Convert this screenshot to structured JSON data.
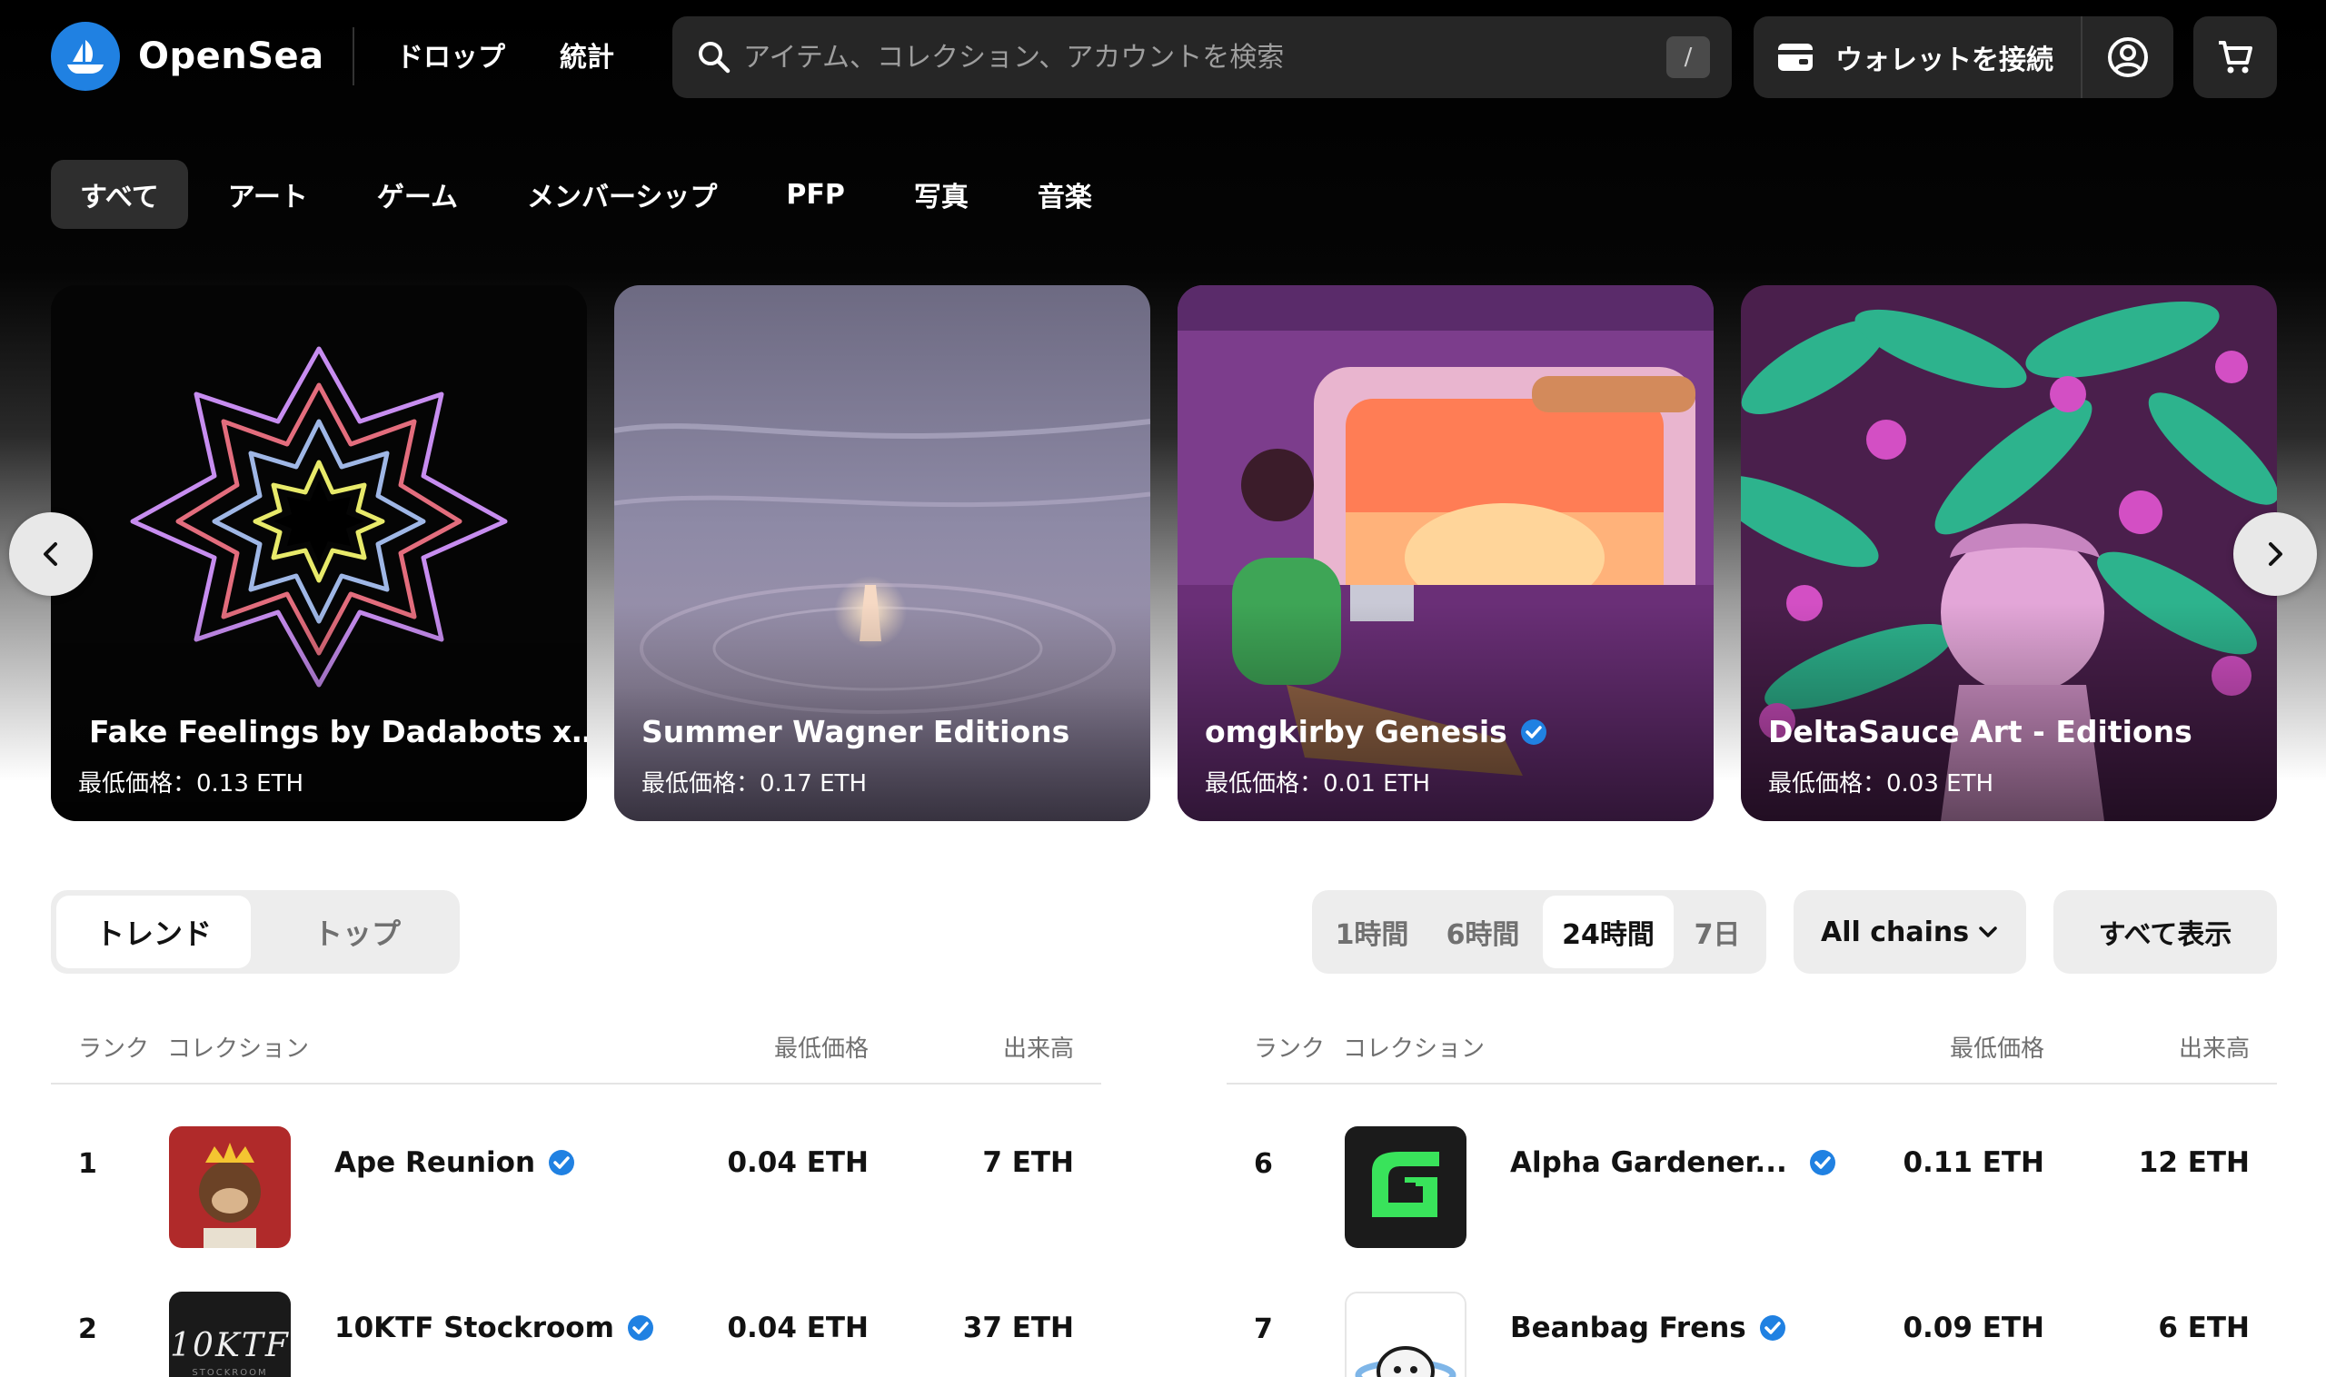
{
  "brand": {
    "name": "OpenSea"
  },
  "nav": {
    "drops": "ドロップ",
    "stats": "統計"
  },
  "search": {
    "placeholder": "アイテム、コレクション、アカウントを検索",
    "shortcut": "/"
  },
  "wallet": {
    "label": "ウォレットを接続"
  },
  "categories": [
    "すべて",
    "アート",
    "ゲーム",
    "メンバーシップ",
    "PFP",
    "写真",
    "音楽"
  ],
  "featured": [
    {
      "title": "Fake Feelings by Dadabots x…",
      "price": "最低価格：0.13 ETH",
      "icon": "music-note-icon"
    },
    {
      "title": "Summer Wagner Editions",
      "price": "最低価格：0.17 ETH"
    },
    {
      "title": "omgkirby Genesis",
      "price": "最低価格：0.01 ETH",
      "verified": true
    },
    {
      "title": "DeltaSauce Art - Editions",
      "price": "最低価格：0.03 ETH"
    }
  ],
  "tabs": {
    "trending": "トレンド",
    "top": "トップ"
  },
  "timeframes": [
    "1時間",
    "6時間",
    "24時間",
    "7日"
  ],
  "chains": {
    "label": "All chains"
  },
  "view_all": "すべて表示",
  "table_headers": {
    "rank": "ランク",
    "collection": "コレクション",
    "floor": "最低価格",
    "volume": "出来高"
  },
  "collections_left": [
    {
      "rank": "1",
      "name": "Ape Reunion",
      "floor": "0.04 ETH",
      "volume": "7 ETH"
    },
    {
      "rank": "2",
      "name": "10KTF Stockroom",
      "floor": "0.04 ETH",
      "volume": "37 ETH",
      "thumb_text": "10KTF",
      "thumb_sub": "STOCKROOM"
    }
  ],
  "collections_right": [
    {
      "rank": "6",
      "name": "Alpha Gardener...",
      "floor": "0.11 ETH",
      "volume": "12 ETH"
    },
    {
      "rank": "7",
      "name": "Beanbag Frens",
      "floor": "0.09 ETH",
      "volume": "6 ETH"
    }
  ],
  "colors": {
    "accent": "#2081E2",
    "header_bg": "#000000",
    "surface": "#262626"
  }
}
